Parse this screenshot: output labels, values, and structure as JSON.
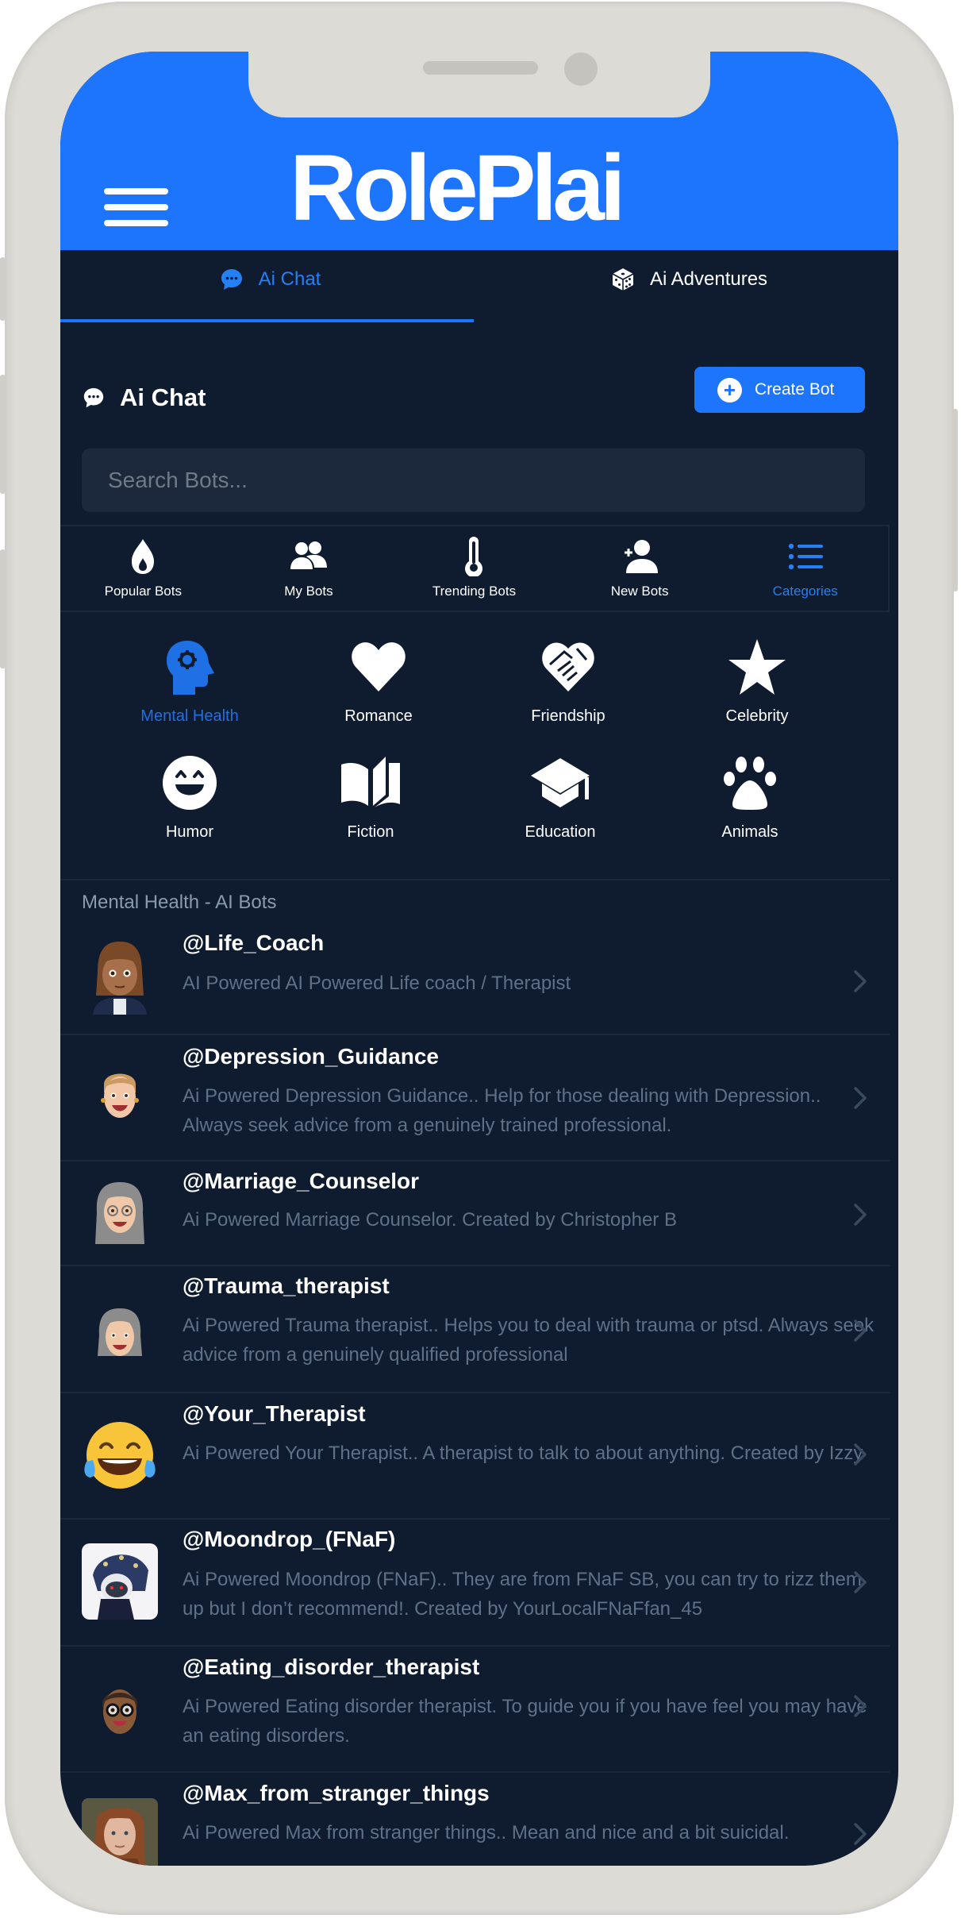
{
  "app": {
    "name": "RolePlai",
    "colors": {
      "brand": "#1d74fd",
      "background": "#0f1b2e",
      "accent_text": "#2680f5",
      "muted_text": "#5f7186",
      "frame": "#dcdbd6"
    }
  },
  "header": {
    "logo_text": "RolePlai",
    "menu_icon": "hamburger-menu-icon"
  },
  "tabs": [
    {
      "label": "Ai Chat",
      "icon": "chat-bubble-icon",
      "active": true
    },
    {
      "label": "Ai Adventures",
      "icon": "dice-icon",
      "active": false
    }
  ],
  "section": {
    "title": "Ai Chat",
    "icon": "chat-bubble-icon",
    "create_button": "Create Bot"
  },
  "search": {
    "placeholder": "Search Bots...",
    "value": ""
  },
  "nav": [
    {
      "label": "Popular Bots",
      "icon": "flame-icon",
      "active": false
    },
    {
      "label": "My Bots",
      "icon": "users-icon",
      "active": false
    },
    {
      "label": "Trending Bots",
      "icon": "thermometer-icon",
      "active": false
    },
    {
      "label": "New Bots",
      "icon": "user-plus-icon",
      "active": false
    },
    {
      "label": "Categories",
      "icon": "list-icon",
      "active": true
    }
  ],
  "categories": [
    {
      "label": "Mental Health",
      "icon": "head-gear-icon",
      "active": true
    },
    {
      "label": "Romance",
      "icon": "heart-icon",
      "active": false
    },
    {
      "label": "Friendship",
      "icon": "handshake-heart-icon",
      "active": false
    },
    {
      "label": "Celebrity",
      "icon": "star-icon",
      "active": false
    },
    {
      "label": "Humor",
      "icon": "smile-icon",
      "active": false
    },
    {
      "label": "Fiction",
      "icon": "book-open-icon",
      "active": false
    },
    {
      "label": "Education",
      "icon": "graduation-cap-icon",
      "active": false
    },
    {
      "label": "Animals",
      "icon": "paw-icon",
      "active": false
    }
  ],
  "list": {
    "label": "Mental Health - AI Bots",
    "bots": [
      {
        "handle": "@Life_Coach",
        "description": "AI Powered AI Powered Life coach / Therapist",
        "avatar": "woman-emoji"
      },
      {
        "handle": "@Depression_Guidance",
        "description": "Ai Powered Depression Guidance.. Help for those dealing with Depression.. Always seek advice from a genuinely trained professional.",
        "avatar": "memoji-blonde"
      },
      {
        "handle": "@Marriage_Counselor",
        "description": "Ai Powered Marriage Counselor. Created by Christopher B",
        "avatar": "memoji-gray-hair-glasses"
      },
      {
        "handle": "@Trauma_therapist",
        "description": "Ai Powered Trauma therapist.. Helps you to deal with trauma or ptsd. Always seek advice from a genuinely qualified professional",
        "avatar": "memoji-gray-hair"
      },
      {
        "handle": "@Your_Therapist",
        "description": "Ai Powered Your Therapist.. A therapist to talk to about anything. Created by Izzy",
        "avatar": "tears-of-joy-emoji"
      },
      {
        "handle": "@Moondrop_(FNaF)",
        "description": "Ai Powered Moondrop (FNaF).. They are from FNaF SB, you can try to rizz them up but I don’t recommend!. Created by YourLocalFNaFfan_45",
        "avatar": "moondrop-image"
      },
      {
        "handle": "@Eating_disorder_therapist",
        "description": "Ai Powered Eating disorder therapist. To guide you if you have feel you may have an eating disorders.",
        "avatar": "memoji-glasses-dark"
      },
      {
        "handle": "@Max_from_stranger_things",
        "description": "Ai Powered Max from stranger things.. Mean and nice and a bit suicidal.",
        "avatar": "photo-redhead"
      }
    ]
  }
}
